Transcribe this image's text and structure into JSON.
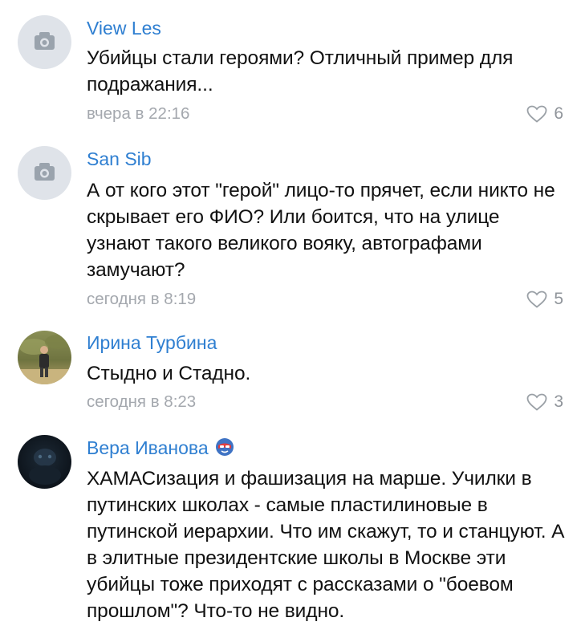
{
  "comments": [
    {
      "author": "View Les",
      "text": "Убийцы стали героями? Отличный пример для подражания...",
      "time": "вчера в 22:16",
      "likes": "6",
      "avatar_icon": "camera-icon"
    },
    {
      "author": "San Sib",
      "text": "А от кого этот \"герой\" лицо-то прячет, если никто не скрывает его ФИО? Или боится, что на улице узнают такого великого вояку, автографами замучают?",
      "time": "сегодня в 8:19",
      "likes": "5",
      "avatar_icon": "camera-icon"
    },
    {
      "author": "Ирина Турбина",
      "text": "Стыдно и Стадно.",
      "time": "сегодня в 8:23",
      "likes": "3",
      "avatar_icon": "user-photo"
    },
    {
      "author": "Вера Иванова",
      "text": "ХАМАСизация и фашизация на марше. Училки в путинских школах - самые пластилиновые в путинской иерархии. Что им скажут, то и станцуют. А в элитные президентские школы в Москве эти убийцы тоже приходят с рассказами о \"боевом прошлом\"? Что-то не видно.",
      "avatar_icon": "user-photo",
      "badge_icon": "mask-badge-icon"
    }
  ],
  "colors": {
    "author": "#2f7fd1",
    "text": "#111111",
    "meta": "#a4a8ae",
    "placeholder_bg": "#dfe3e9"
  }
}
